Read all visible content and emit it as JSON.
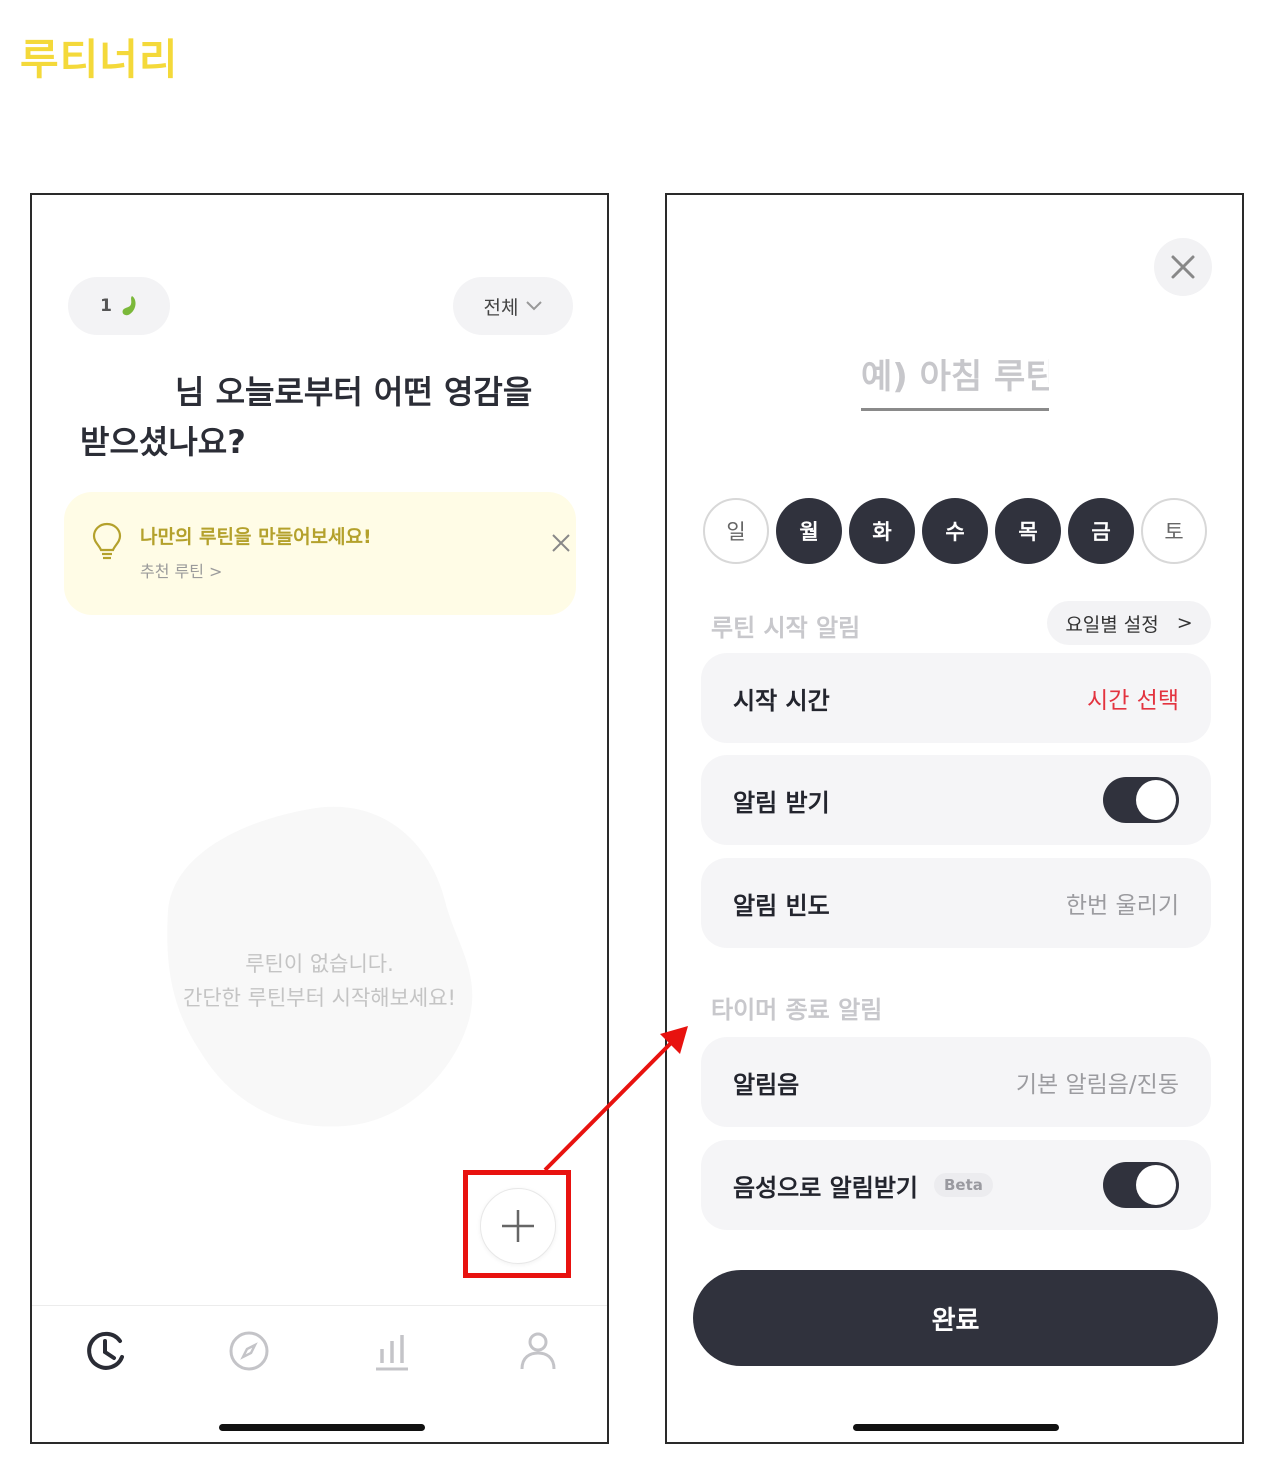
{
  "app_title": "루티너리",
  "left_screen": {
    "seed_count": "1",
    "filter_label": "전체",
    "greeting_line1": "님 오늘로부터 어떤 영감을",
    "greeting_line2": "받으셨나요?",
    "tip": {
      "title": "나만의 루틴을 만들어보세요!",
      "link": "추천 루틴 >"
    },
    "empty_line1": "루틴이 없습니다.",
    "empty_line2": "간단한 루틴부터 시작해보세요!",
    "tabs": [
      "routine-clock-icon",
      "explore-compass-icon",
      "stats-bar-icon",
      "profile-person-icon"
    ]
  },
  "right_screen": {
    "name_placeholder": "예) 아침 루틴",
    "days": [
      {
        "label": "일",
        "selected": false
      },
      {
        "label": "월",
        "selected": true
      },
      {
        "label": "화",
        "selected": true
      },
      {
        "label": "수",
        "selected": true
      },
      {
        "label": "목",
        "selected": true
      },
      {
        "label": "금",
        "selected": true
      },
      {
        "label": "토",
        "selected": false
      }
    ],
    "start_alarm_section": "루틴 시작 알림",
    "weekday_setting": "요일별 설정",
    "weekday_chevron": ">",
    "start_time_label": "시작 시간",
    "start_time_value": "시간 선택",
    "receive_alarm_label": "알림 받기",
    "receive_alarm_on": true,
    "alarm_freq_label": "알림 빈도",
    "alarm_freq_value": "한번 울리기",
    "timer_end_section": "타이머 종료 알림",
    "sound_label": "알림음",
    "sound_value": "기본 알림음/진동",
    "voice_label": "음성으로 알림받기",
    "voice_badge": "Beta",
    "voice_on": true,
    "done_label": "완료"
  },
  "colors": {
    "logo": "#f4d93a",
    "dark": "#30323d",
    "accent_red": "#e3333f",
    "annotation_red": "#e8120f",
    "tip_bg": "#fffce6"
  }
}
